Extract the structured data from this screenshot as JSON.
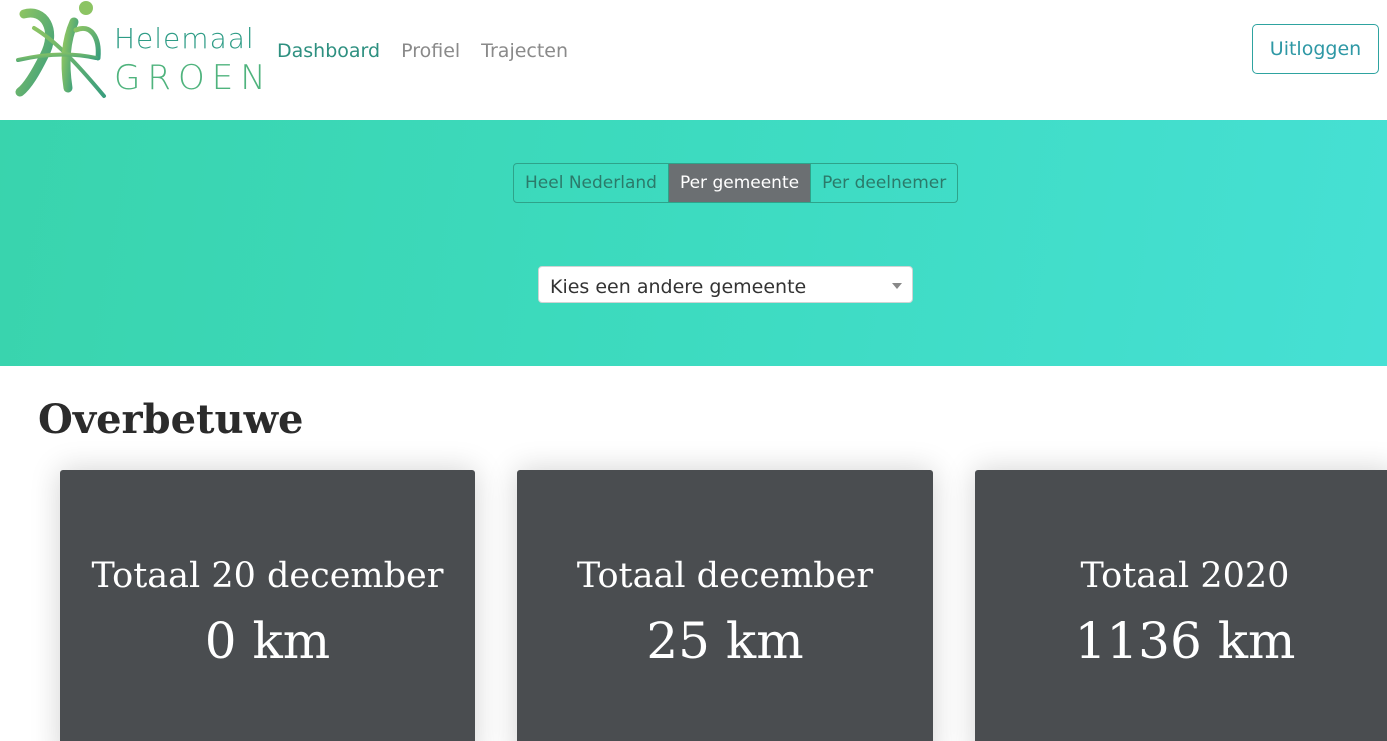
{
  "brand": {
    "name_top": "Helemaal",
    "name_bottom": "GROEN",
    "logo_icon": "figures-logo-icon"
  },
  "nav": {
    "items": [
      {
        "label": "Dashboard",
        "active": true
      },
      {
        "label": "Profiel",
        "active": false
      },
      {
        "label": "Trajecten",
        "active": false
      }
    ],
    "logout_label": "Uitloggen"
  },
  "filter": {
    "tabs": [
      {
        "label": "Heel Nederland",
        "selected": false
      },
      {
        "label": "Per gemeente",
        "selected": true
      },
      {
        "label": "Per deelnemer",
        "selected": false
      }
    ],
    "select_value": "Kies een andere gemeente"
  },
  "main": {
    "title": "Overbetuwe",
    "cards": [
      {
        "label": "Totaal 20 december",
        "value": "0 km"
      },
      {
        "label": "Totaal december",
        "value": "25 km"
      },
      {
        "label": "Totaal 2020",
        "value": "1136 km"
      }
    ]
  },
  "colors": {
    "accent": "#2e9080",
    "hero_start": "#39d4ad",
    "hero_end": "#46e0d4",
    "card_bg": "#4a4d50",
    "segment_selected": "#6b6f72"
  }
}
